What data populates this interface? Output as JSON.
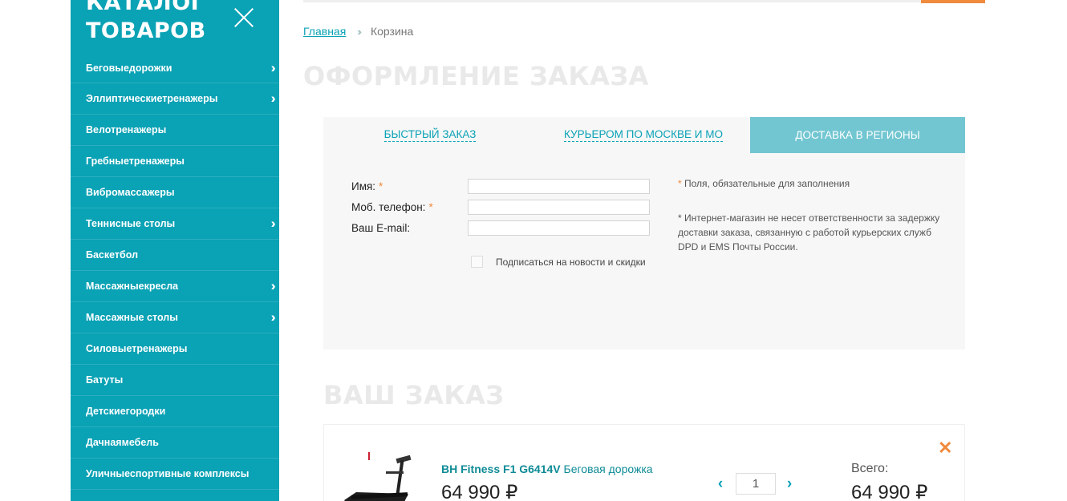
{
  "sidebar": {
    "title": "КАТАЛОГ ТОВАРОВ",
    "items": [
      {
        "label": "Беговыедорожки",
        "has_arrow": true
      },
      {
        "label": "Эллиптическиетренажеры",
        "has_arrow": true
      },
      {
        "label": "Велотренажеры",
        "has_arrow": false
      },
      {
        "label": "Гребныетренажеры",
        "has_arrow": false
      },
      {
        "label": "Вибромассажеры",
        "has_arrow": false
      },
      {
        "label": "Теннисные столы",
        "has_arrow": true
      },
      {
        "label": "Баскетбол",
        "has_arrow": false
      },
      {
        "label": "Массажныекресла",
        "has_arrow": true
      },
      {
        "label": "Массажные столы",
        "has_arrow": true
      },
      {
        "label": "Силовыетренажеры",
        "has_arrow": false
      },
      {
        "label": "Батуты",
        "has_arrow": false
      },
      {
        "label": "Детскиегородки",
        "has_arrow": false
      },
      {
        "label": "Дачнаямебель",
        "has_arrow": false
      },
      {
        "label": "Уличныеспортивные комплексы",
        "has_arrow": false
      }
    ],
    "arrow_icon": "double-chevron-right-icon",
    "close_icon": "close-icon"
  },
  "breadcrumb": {
    "home": "Главная",
    "separator": "»",
    "current": "Корзина"
  },
  "page_title": "ОФОРМЛЕНИЕ ЗАКАЗА",
  "tabs": [
    {
      "label": "БЫСТРЫЙ ЗАКАЗ",
      "active": false
    },
    {
      "label": "КУРЬЕРОМ ПО МОСКВЕ И МО",
      "active": false
    },
    {
      "label": "ДОСТАВКА В РЕГИОНЫ",
      "active": true
    }
  ],
  "form": {
    "name_label": "Имя:",
    "phone_label": "Моб. телефон:",
    "email_label": "Ваш E-mail:",
    "required_mark": "*",
    "name_value": "",
    "phone_value": "",
    "email_value": "",
    "subscribe_label": "Подписаться на новости и скидки",
    "subscribe_checked": false
  },
  "notes": {
    "star": "*",
    "required_note": "Поля, обязательные для заполнения",
    "liability_note": "* Интернет-магазин не несет ответственности за задержку доставки заказа, связанную с работой курьерских служб DPD и EMS Почты России."
  },
  "order": {
    "title": "ВАШ ЗАКАЗ",
    "product_brand": "BH Fitness F1 G6414V",
    "product_type": "Беговая дорожка",
    "price": "64 990 ₽",
    "quantity": "1",
    "total_label": "Всего:",
    "total_value": "64 990 ₽",
    "remove_icon": "close-x-icon"
  },
  "colors": {
    "sidebar_bg": "#0aa2b5",
    "accent": "#f08a3c",
    "active_tab": "#72c6d1",
    "link": "#0aa2b5"
  }
}
